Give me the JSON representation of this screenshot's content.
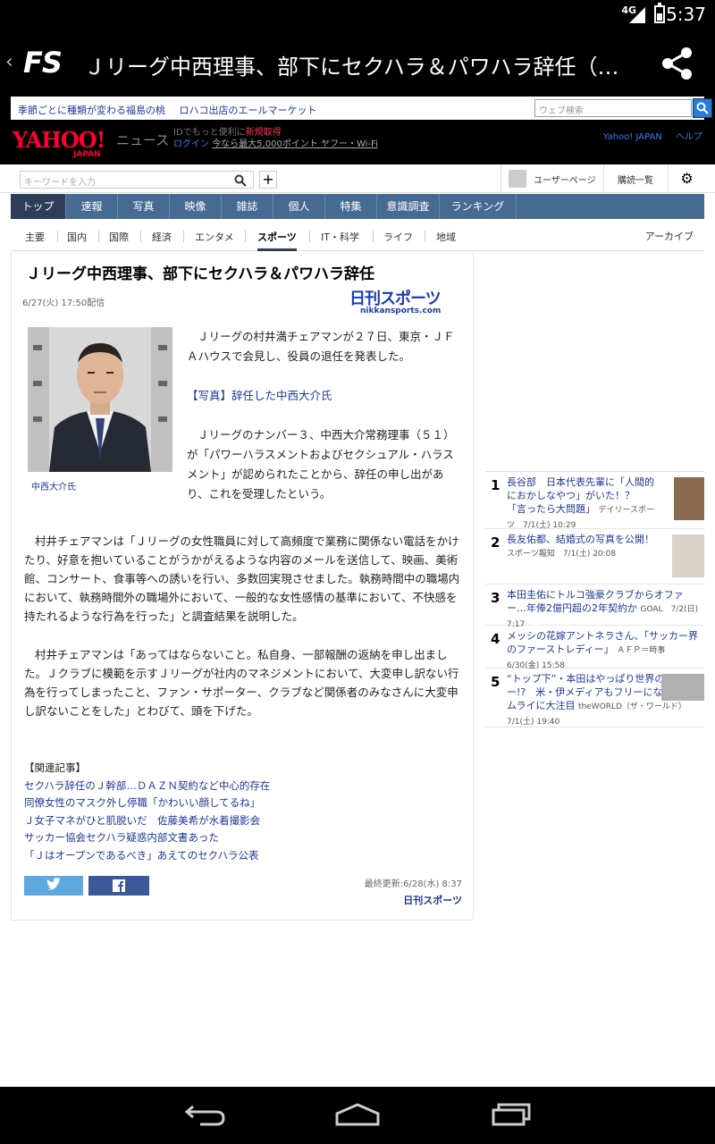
{
  "status": {
    "network": "4G",
    "time": "5:37"
  },
  "app": {
    "back": "‹",
    "logo": "FS",
    "title": "Ｊリーグ中西理事、部下にセクハラ＆パワハラ辞任（…"
  },
  "promo": {
    "links": [
      "季節ごとに種類が変わる福島の桃",
      "ロハコ出店のエールマーケット"
    ],
    "web_search_placeholder": "ウェブ検索"
  },
  "yahoo": {
    "logo": "YAHOO!",
    "japan": "JAPAN",
    "news": "ニュース",
    "login_line1_pre": "IDでもっと便利に",
    "login_line1_link": "新規取得",
    "login_line2_login": "ログイン",
    "login_line2_promo": "今なら最大5,000ポイント ヤフー・Wi-Fi",
    "links": [
      "Yahoo! JAPAN",
      "ヘルプ"
    ]
  },
  "toolbar": {
    "keyword_placeholder": "キーワードを入力",
    "plus": "+",
    "user_page": "ユーザーページ",
    "subscriptions": "購読一覧"
  },
  "nav": {
    "items": [
      "トップ",
      "速報",
      "写真",
      "映像",
      "雑誌",
      "個人",
      "特集",
      "意識調査",
      "ランキング"
    ],
    "active": "トップ"
  },
  "subnav": {
    "items": [
      "主要",
      "国内",
      "国際",
      "経済",
      "エンタメ",
      "スポーツ",
      "IT・科学",
      "ライフ",
      "地域"
    ],
    "active": "スポーツ",
    "archive": "アーカイブ"
  },
  "article": {
    "headline": "Ｊリーグ中西理事、部下にセクハラ＆パワハラ辞任",
    "date": "6/27(火) 17:50配信",
    "source_logo": "日刊スポーツ",
    "source_logo_url": "nikkansports.com",
    "photo_caption": "中西大介氏",
    "lead_paragraphs": [
      "Ｊリーグの村井満チェアマンが２７日、東京・ＪＦＡハウスで会見し、役員の退任を発表した。",
      "Ｊリーグのナンバー３、中西大介常務理事（５１）が「パワーハラスメントおよびセクシュアル・ハラスメント」が認められたことから、辞任の申し出があり、これを受理したという。"
    ],
    "photo_link": "【写真】辞任した中西大介氏",
    "body_paragraphs": [
      "村井チェアマンは「Ｊリーグの女性職員に対して高頻度で業務に関係ない電話をかけたり、好意を抱いていることがうかがえるような内容のメールを送信して、映画、美術館、コンサート、食事等への誘いを行い、多数回実現させました。執務時間中の職場内において、執務時間外の職場外において、一般的な女性感情の基準において、不快感を持たれるような行為を行った」と調査結果を説明した。",
      "村井チェアマンは「あってはならないこと。私自身、一部報酬の返納を申し出ました。Ｊクラブに模範を示すＪリーグが社内のマネジメントにおいて、大変申し訳ない行為を行ってしまったこと、ファン・サポーター、クラブなど関係者のみなさんに大変申し訳ないことをした」とわびて、頭を下げた。"
    ],
    "related_heading": "【関連記事】",
    "related": [
      "セクハラ辞任のＪ幹部…ＤＡＺＮ契約など中心的存在",
      "同僚女性のマスク外し停職「かわいい顔してるね」",
      "Ｊ女子マネがひと肌脱いだ　佐藤美希が水着撮影会",
      "サッカー協会セクハラ疑惑内部文書あった",
      "「Ｊはオープンであるべき」あえてのセクハラ公表"
    ],
    "updated": "最終更新:6/28(水) 8:37",
    "source_footer": "日刊スポーツ"
  },
  "ranking": {
    "items": [
      {
        "num": "1",
        "title": "長谷部　日本代表先輩に「人間的におかしなやつ」がいた！？　「言ったら大問題」",
        "meta": "デイリースポーツ　7/1(土) 10:29"
      },
      {
        "num": "2",
        "title": "長友佑都、結婚式の写真を公開！",
        "meta": "スポーツ報知　7/1(土) 20:08"
      },
      {
        "num": "3",
        "title": "本田圭佑にトルコ強豪クラブからオファー…年俸2億円超の2年契約か",
        "meta": "GOAL　7/2(日) 7:17"
      },
      {
        "num": "4",
        "title": "メッシの花嫁アントネラさん、「サッカー界のファーストレディー」",
        "meta": "ＡＦＰ＝時事　6/30(金) 15:58"
      },
      {
        "num": "5",
        "title": "“トップ下”・本田はやっぱり世界のスター!?　米・伊メディアもフリーになったサムライに大注目",
        "meta": "theWORLD（ザ・ワールド）　7/1(土) 19:40"
      }
    ]
  },
  "colors": {
    "nav": "#476a93",
    "nav_active": "#2e3e58",
    "link": "#1d3994",
    "yahoo_red": "#ff0033"
  }
}
